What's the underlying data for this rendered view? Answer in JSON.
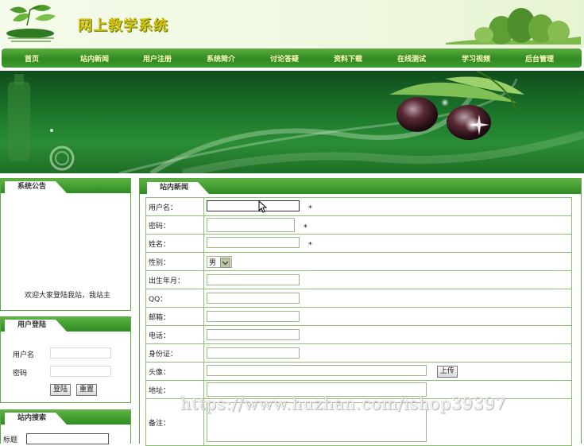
{
  "header": {
    "site_title": "网上教学系统"
  },
  "nav": {
    "items": [
      "首页",
      "站内新闻",
      "用户注册",
      "系统简介",
      "讨论答疑",
      "资料下载",
      "在线测试",
      "学习视频",
      "后台管理"
    ]
  },
  "announcement": {
    "title": "系统公告",
    "text": "欢迎大家登陆我站，我站主"
  },
  "login": {
    "title": "用户登陆",
    "username_label": "用户名",
    "password_label": "密码",
    "login_button": "登陆",
    "reset_button": "重置"
  },
  "search": {
    "title": "站内搜索",
    "field_label": "标题"
  },
  "main": {
    "title": "站内新闻",
    "fields": {
      "username": "用户名：",
      "password": "密码：",
      "name": "姓名：",
      "gender": "性别：",
      "birthday": "出生年月：",
      "qq": "QQ：",
      "email": "邮箱：",
      "phone": "电话：",
      "id_card": "身份证：",
      "avatar": "头像：",
      "address": "地址：",
      "remark": "备注："
    },
    "required_mark": "*",
    "gender_value": "男",
    "upload_button": "上传"
  },
  "watermark": "https://www.huzhan.com/ishop39397",
  "colors": {
    "nav_green": "#2f8a22",
    "title_yellow": "#d4bf10",
    "border_green": "#5fa84a"
  }
}
